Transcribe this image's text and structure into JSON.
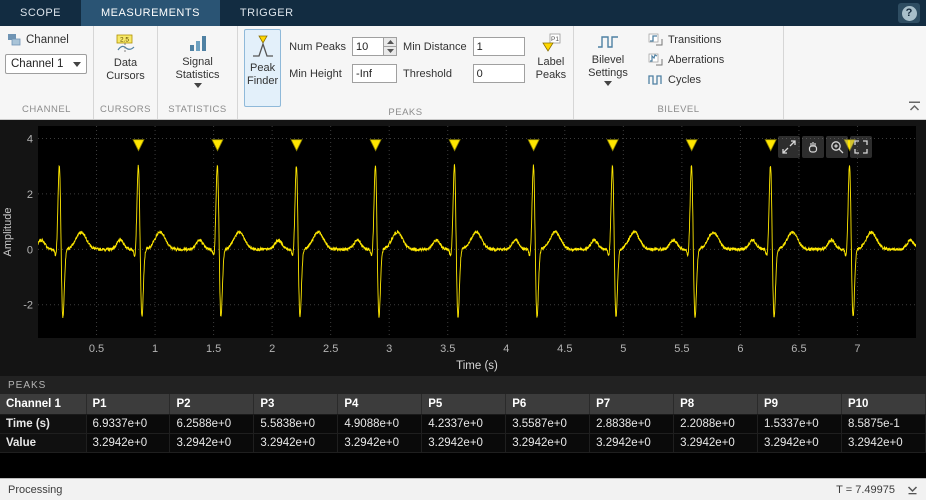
{
  "window": {
    "help_label": "?"
  },
  "tabs": [
    {
      "label": "SCOPE",
      "active": false
    },
    {
      "label": "MEASUREMENTS",
      "active": true
    },
    {
      "label": "TRIGGER",
      "active": false
    }
  ],
  "toolbar": {
    "sections": {
      "channel": "CHANNEL",
      "cursors": "CURSORS",
      "statistics": "STATISTICS",
      "peaks": "PEAKS",
      "bilevel": "BILEVEL"
    },
    "channel": {
      "label": "Channel",
      "selected": "Channel 1"
    },
    "cursors": {
      "label": "Data Cursors",
      "badge": "2.5"
    },
    "statistics": {
      "label": "Signal Statistics"
    },
    "peaks": {
      "toggle_label": "Peak Finder",
      "fields": [
        {
          "label": "Num Peaks",
          "value": "10"
        },
        {
          "label": "Min Height",
          "value": "-Inf"
        },
        {
          "label": "Min Distance",
          "value": "1"
        },
        {
          "label": "Threshold",
          "value": "0"
        }
      ],
      "label_peaks": "Label Peaks"
    },
    "bilevel": {
      "settings_label": "Bilevel Settings",
      "buttons": [
        {
          "label": "Transitions"
        },
        {
          "label": "Aberrations"
        },
        {
          "label": "Cycles"
        }
      ]
    }
  },
  "chart_data": {
    "type": "line",
    "title": "",
    "xlabel": "Time (s)",
    "ylabel": "Amplitude",
    "xlim": [
      0,
      7.5
    ],
    "ylim": [
      -3.2,
      4.45
    ],
    "grid": true,
    "background": "#000000",
    "line_color": "#ffe800",
    "xticks": [
      {
        "v": 0.5,
        "label": "0.5"
      },
      {
        "v": 1,
        "label": "1"
      },
      {
        "v": 1.5,
        "label": "1.5"
      },
      {
        "v": 2,
        "label": "2"
      },
      {
        "v": 2.5,
        "label": "2.5"
      },
      {
        "v": 3,
        "label": "3"
      },
      {
        "v": 3.5,
        "label": "3.5"
      },
      {
        "v": 4,
        "label": "4"
      },
      {
        "v": 4.5,
        "label": "4.5"
      },
      {
        "v": 5,
        "label": "5"
      },
      {
        "v": 5.5,
        "label": "5.5"
      },
      {
        "v": 6,
        "label": "6"
      },
      {
        "v": 6.5,
        "label": "6.5"
      },
      {
        "v": 7,
        "label": "7"
      }
    ],
    "yticks": [
      {
        "v": 4,
        "label": "4"
      },
      {
        "v": 2,
        "label": "2"
      },
      {
        "v": 0,
        "label": "0"
      },
      {
        "v": -2,
        "label": "-2"
      }
    ],
    "series": [
      {
        "name": "Channel 1",
        "signal": "ecg",
        "period": 0.675,
        "first_peak_time": 0.18375,
        "beats": 12,
        "noise_amp": 0.055,
        "components": [
          {
            "offset": 0.0,
            "width": 0.012,
            "amp": 3.29
          },
          {
            "offset": -0.03,
            "width": 0.009,
            "amp": -0.3
          },
          {
            "offset": 0.027,
            "width": 0.013,
            "amp": -2.65
          },
          {
            "offset": -0.155,
            "width": 0.03,
            "amp": 0.33
          },
          {
            "offset": 0.185,
            "width": 0.045,
            "amp": 0.62
          }
        ]
      }
    ],
    "peaks": {
      "marker": "triangle-down",
      "color": "#ffe600",
      "value": 3.2942,
      "times": [
        0.85875,
        1.5337,
        2.2088,
        2.8838,
        3.5587,
        4.2337,
        4.9088,
        5.5838,
        6.2588,
        6.9337
      ]
    }
  },
  "plot_tools": [
    {
      "name": "maximize"
    },
    {
      "name": "pan"
    },
    {
      "name": "zoom-in"
    },
    {
      "name": "fit-to-view"
    }
  ],
  "peaks_panel": {
    "title": "PEAKS",
    "columns": [
      "Channel 1",
      "P1",
      "P2",
      "P3",
      "P4",
      "P5",
      "P6",
      "P7",
      "P8",
      "P9",
      "P10"
    ],
    "rows": [
      {
        "label": "Time (s)",
        "values": [
          "6.9337e+0",
          "6.2588e+0",
          "5.5838e+0",
          "4.9088e+0",
          "4.2337e+0",
          "3.5587e+0",
          "2.8838e+0",
          "2.2088e+0",
          "1.5337e+0",
          "8.5875e-1"
        ]
      },
      {
        "label": "Value",
        "values": [
          "3.2942e+0",
          "3.2942e+0",
          "3.2942e+0",
          "3.2942e+0",
          "3.2942e+0",
          "3.2942e+0",
          "3.2942e+0",
          "3.2942e+0",
          "3.2942e+0",
          "3.2942e+0"
        ]
      }
    ]
  },
  "status": {
    "left": "Processing",
    "right": "T = 7.49975"
  }
}
